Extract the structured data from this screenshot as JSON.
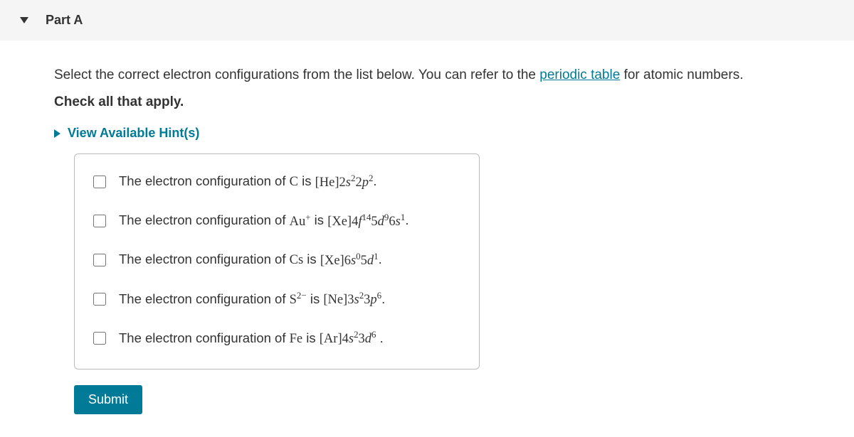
{
  "header": {
    "part_label": "Part A"
  },
  "prompt": {
    "text_before_link": "Select the correct electron configurations from the list below. You can refer to the ",
    "link_text": "periodic table",
    "text_after_link": " for atomic numbers.",
    "check_all": "Check all that apply."
  },
  "hints": {
    "label": "View Available Hint(s)"
  },
  "options": [
    {
      "prefix": "The electron configuration of ",
      "species_base": "C",
      "species_charge": "",
      "is_text": " is ",
      "noble": "He",
      "orbitals": [
        {
          "shell": "2",
          "sub": "s",
          "sup": "2"
        },
        {
          "shell": "2",
          "sub": "p",
          "sup": "2"
        }
      ],
      "suffix": "."
    },
    {
      "prefix": "The electron configuration of ",
      "species_base": "Au",
      "species_charge": "+",
      "is_text": " is ",
      "noble": "Xe",
      "orbitals": [
        {
          "shell": "4",
          "sub": "f",
          "sup": "14"
        },
        {
          "shell": "5",
          "sub": "d",
          "sup": "9"
        },
        {
          "shell": "6",
          "sub": "s",
          "sup": "1"
        }
      ],
      "suffix": "."
    },
    {
      "prefix": "The electron configuration of ",
      "species_base": "Cs",
      "species_charge": "",
      "is_text": " is ",
      "noble": "Xe",
      "orbitals": [
        {
          "shell": "6",
          "sub": "s",
          "sup": "0"
        },
        {
          "shell": "5",
          "sub": "d",
          "sup": "1"
        }
      ],
      "suffix": "."
    },
    {
      "prefix": "The electron configuration of ",
      "species_base": "S",
      "species_charge": "2−",
      "is_text": " is ",
      "noble": "Ne",
      "orbitals": [
        {
          "shell": "3",
          "sub": "s",
          "sup": "2"
        },
        {
          "shell": "3",
          "sub": "p",
          "sup": "6"
        }
      ],
      "suffix": "."
    },
    {
      "prefix": "The electron configuration of ",
      "species_base": "Fe",
      "species_charge": "",
      "is_text": " is ",
      "noble": "Ar",
      "orbitals": [
        {
          "shell": "4",
          "sub": "s",
          "sup": "2"
        },
        {
          "shell": "3",
          "sub": "d",
          "sup": "6"
        }
      ],
      "suffix": " ."
    }
  ],
  "submit": {
    "label": "Submit"
  }
}
